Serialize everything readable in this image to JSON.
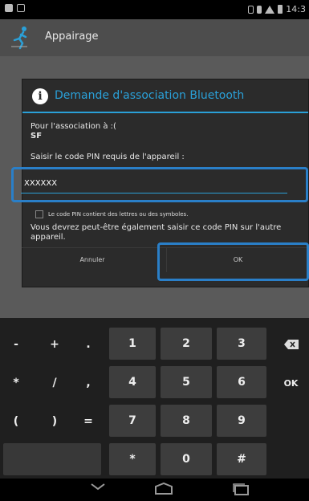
{
  "statusbar": {
    "time": "14:3"
  },
  "app": {
    "title": "Appairage"
  },
  "dialog": {
    "title": "Demande d'association Bluetooth",
    "pairing_label": "Pour l'association à :(",
    "device_name": "SF",
    "pin_prompt": "Saisir le code PIN requis de l'appareil :",
    "pin_value": "XXXXXX",
    "checkbox_label": "Le code PIN contient des lettres ou des symboles.",
    "note_line1": "Vous devrez peut-être également saisir ce code PIN sur l'autre",
    "note_line2": "appareil.",
    "cancel_label": "Annuler",
    "ok_label": "OK"
  },
  "keyboard": {
    "row1": [
      "-",
      "+",
      ".",
      "1",
      "2",
      "3"
    ],
    "row2": [
      "*",
      "/",
      ",",
      "4",
      "5",
      "6"
    ],
    "row3": [
      "(",
      ")",
      "=",
      "7",
      "8",
      "9"
    ],
    "row4": [
      "*",
      "0",
      "#"
    ],
    "ok_label": "OK",
    "delete_icon": "backspace-icon"
  },
  "colors": {
    "accent": "#2aa0d8",
    "highlight": "#2a7fc8"
  }
}
